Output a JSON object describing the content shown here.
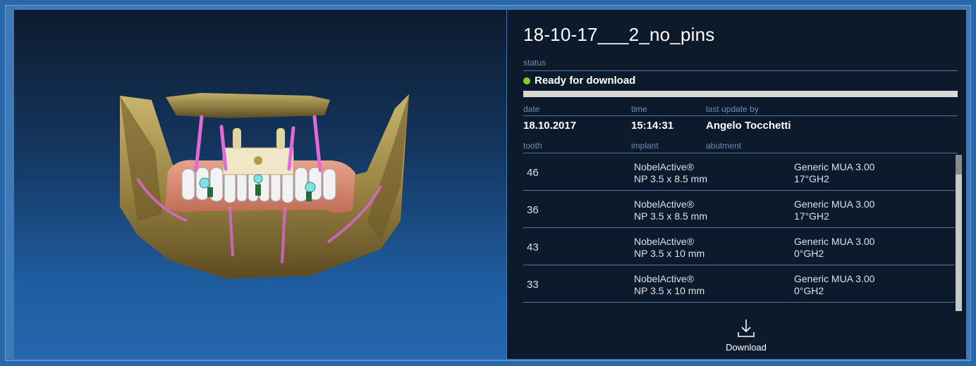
{
  "case": {
    "title": "18-10-17___2_no_pins"
  },
  "status": {
    "label": "status",
    "text": "Ready for download",
    "color": "#7ed321",
    "progress": 1.0
  },
  "meta": {
    "date_label": "date",
    "time_label": "time",
    "updater_label": "last update by",
    "date": "18.10.2017",
    "time": "15:14:31",
    "updater": "Angelo Tocchetti"
  },
  "table": {
    "headers": [
      "tooth",
      "implant",
      "abutment"
    ],
    "rows": [
      {
        "tooth": "46",
        "implant_1": "NobelActive®",
        "implant_2": "NP 3.5 x 8.5 mm",
        "abutment_1": "Generic MUA 3.00",
        "abutment_2": "17°GH2"
      },
      {
        "tooth": "36",
        "implant_1": "NobelActive®",
        "implant_2": "NP 3.5 x 8.5 mm",
        "abutment_1": "Generic MUA 3.00",
        "abutment_2": "17°GH2"
      },
      {
        "tooth": "43",
        "implant_1": "NobelActive®",
        "implant_2": "NP 3.5 x 10 mm",
        "abutment_1": "Generic MUA 3.00",
        "abutment_2": "0°GH2"
      },
      {
        "tooth": "33",
        "implant_1": "NobelActive®",
        "implant_2": "NP 3.5 x 10 mm",
        "abutment_1": "Generic MUA 3.00",
        "abutment_2": "0°GH2"
      }
    ]
  },
  "actions": {
    "download_label": "Download",
    "download_icon": "download-icon"
  },
  "colors": {
    "panel_bg": "#0c1a2c",
    "divider": "#4a76a8",
    "label": "#6b8fb2",
    "status_ok": "#7ed321"
  }
}
